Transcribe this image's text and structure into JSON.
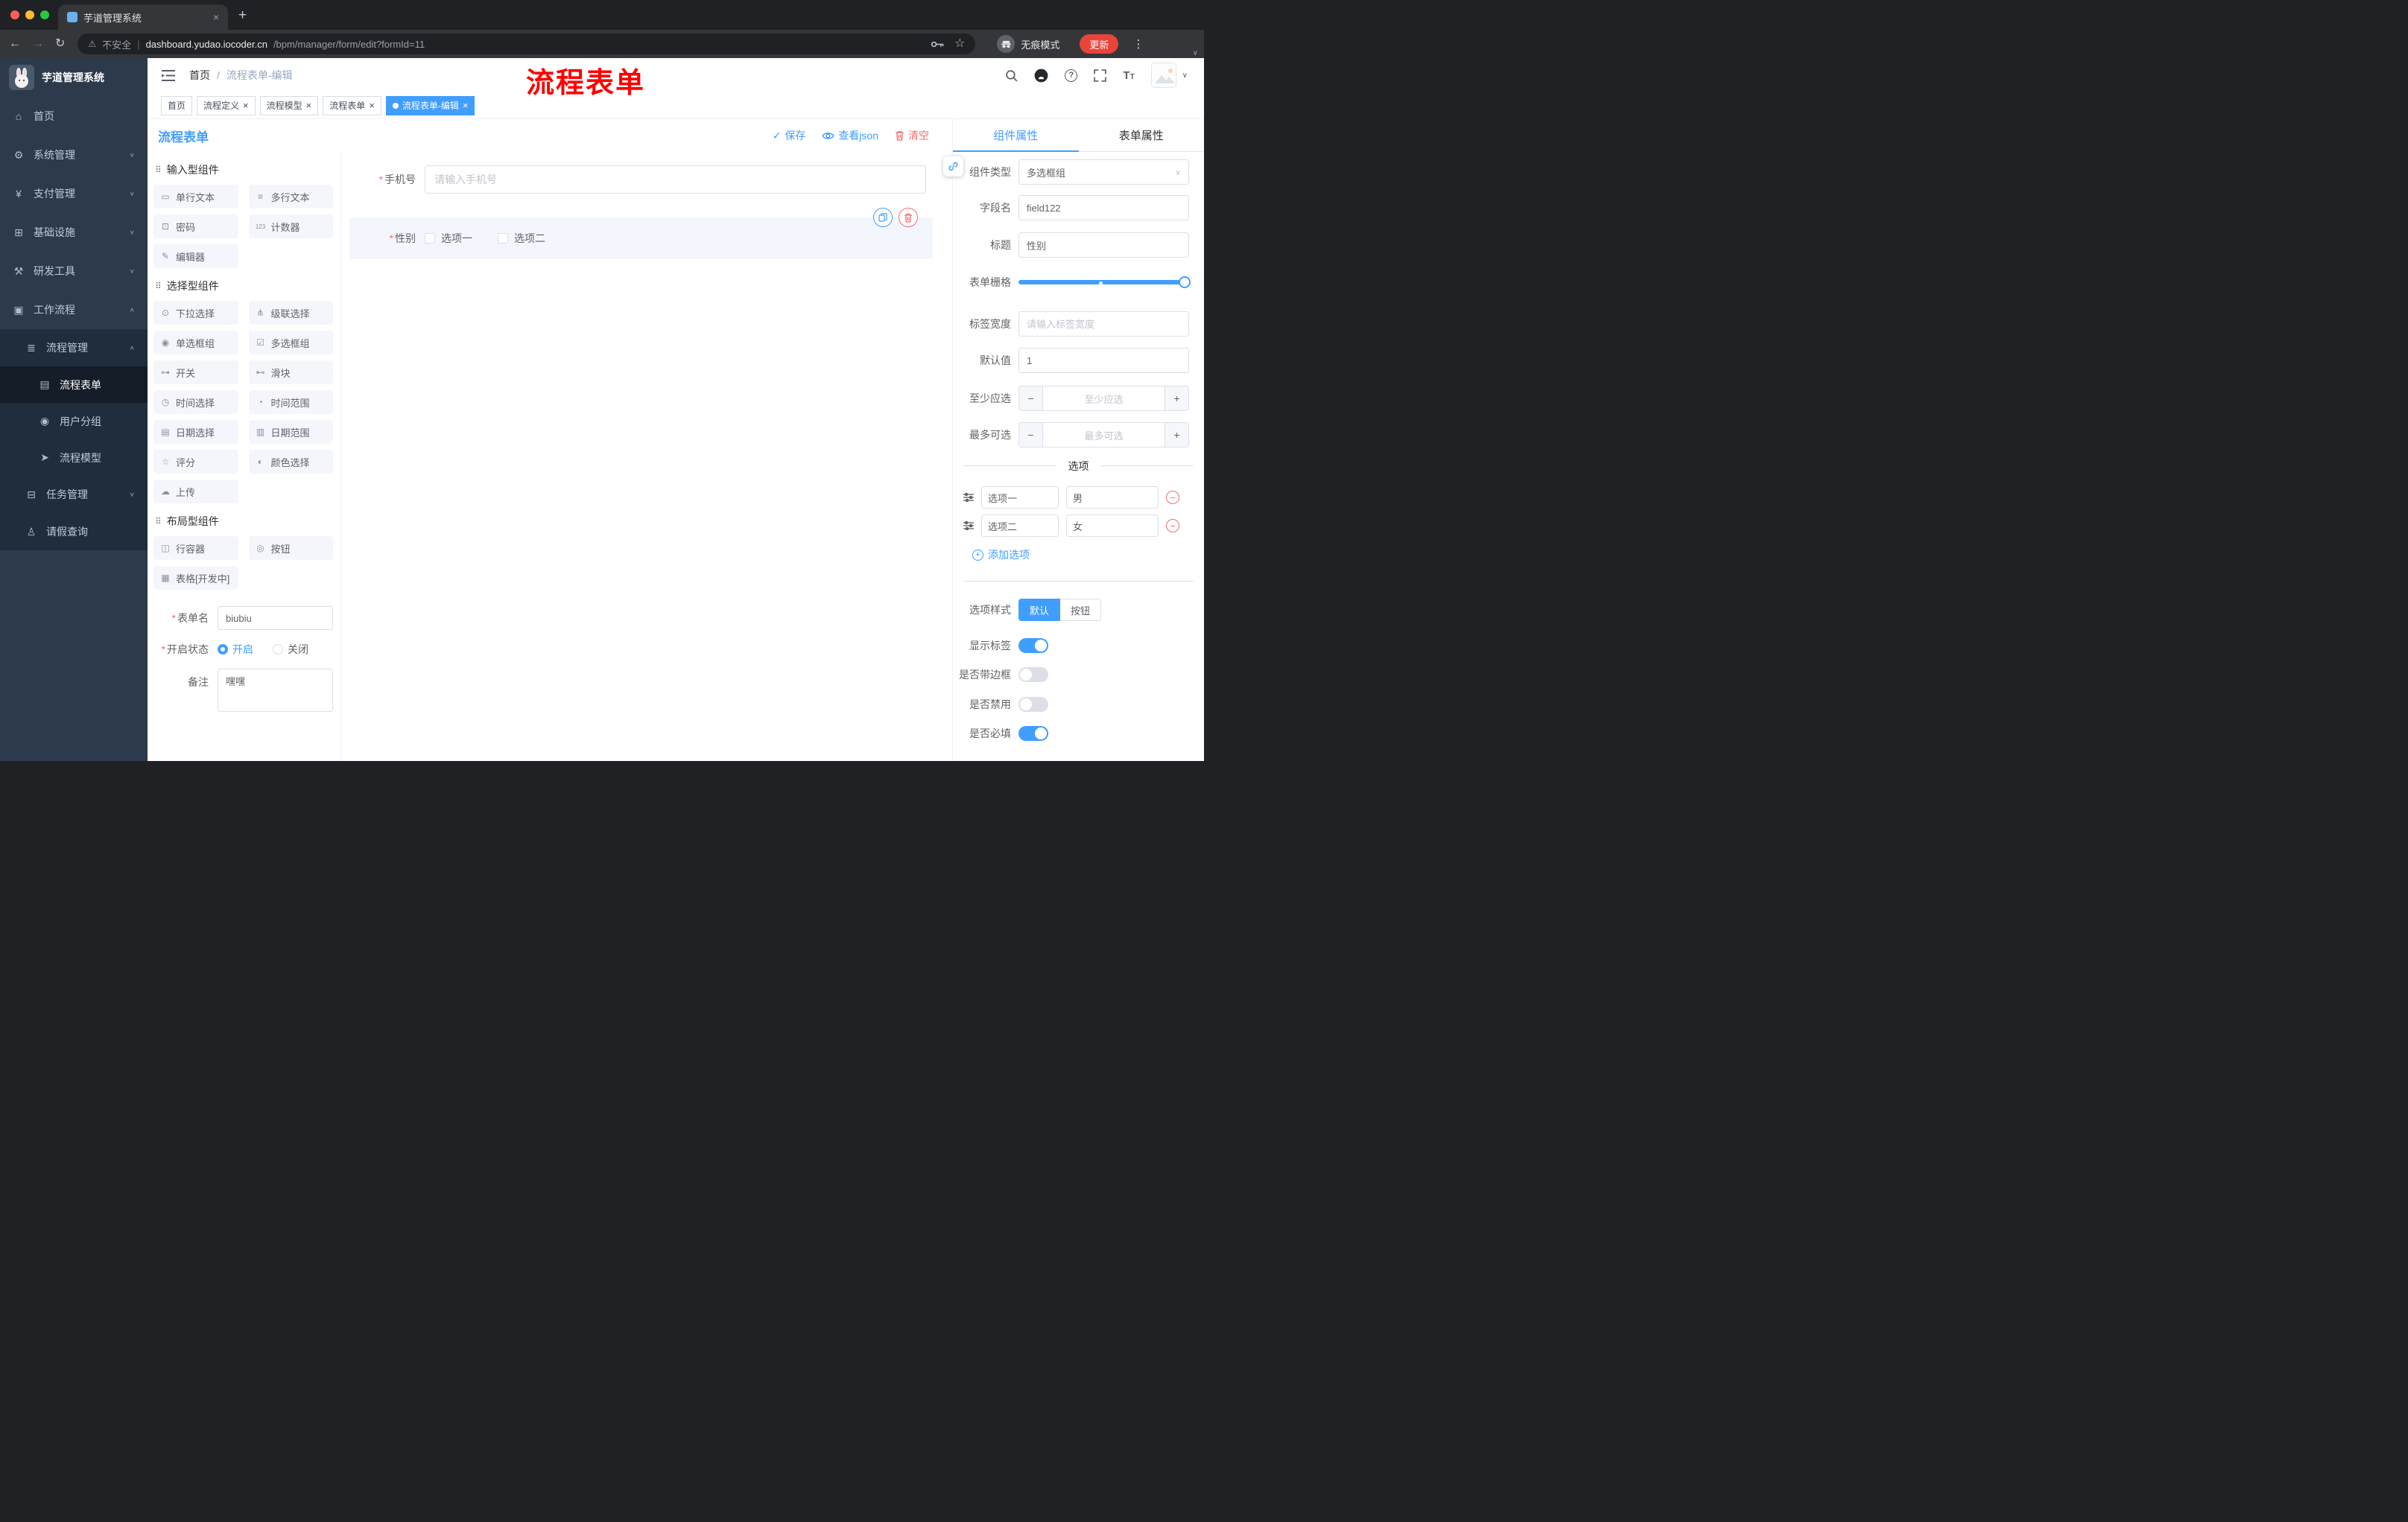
{
  "colors": {
    "primary": "#409EFF",
    "danger": "#F56C6C",
    "sidebar_bg": "#2D3A4B",
    "submenu_bg": "#1F2D3D",
    "annotation_red": "#FE0100",
    "update_button": "#E8443B",
    "tag_active": "#409EFF"
  },
  "icons": {
    "close": "×",
    "plus": "+",
    "minus": "−",
    "back": "←",
    "forward": "→",
    "reload": "↻",
    "warning": "⚠",
    "pipe": "|",
    "star": "☆",
    "menu_dots": "⋮",
    "chevron_down": "∨",
    "chevron_up": "∧",
    "required": "*",
    "check": "✓",
    "question": "?",
    "font_size": "T",
    "home": "⌂",
    "system": "⚙",
    "pay": "¥",
    "infra": "⊞",
    "devtools": "⚒",
    "workflow": "▣",
    "process_mgmt": "≣",
    "form": "▤",
    "users": "◉",
    "model": "➤",
    "task": "⊟",
    "leave": "♙",
    "drag": "⠿",
    "chip_input": "▭",
    "chip_textarea": "≡",
    "chip_password": "⊡",
    "chip_counter": "123",
    "chip_editor": "✎",
    "chip_select": "⊙",
    "chip_cascade": "⋔",
    "chip_radio": "◉",
    "chip_checkbox": "☑",
    "chip_switch": "⊶",
    "chip_slider": "⊷",
    "chip_time": "◷",
    "chip_time_range": "◔",
    "chip_date": "▤",
    "chip_date_range": "▥",
    "chip_rate": "☆",
    "chip_color": "◐",
    "chip_upload": "☁",
    "chip_row": "◫",
    "chip_button": "◎",
    "chip_table": "▦"
  },
  "browser": {
    "tab_title": "芋道管理系统",
    "security_label": "不安全",
    "url_host": "dashboard.yudao.iocoder.cn",
    "url_path": "/bpm/manager/form/edit?formId=11",
    "incognito_label": "无痕模式",
    "update_label": "更新"
  },
  "annotation": {
    "text": "流程表单"
  },
  "sidebar": {
    "logo_title": "芋道管理系统",
    "items": [
      {
        "label": "首页"
      },
      {
        "label": "系统管理"
      },
      {
        "label": "支付管理"
      },
      {
        "label": "基础设施"
      },
      {
        "label": "研发工具"
      },
      {
        "label": "工作流程"
      },
      {
        "label": "流程管理"
      },
      {
        "label": "流程表单"
      },
      {
        "label": "用户分组"
      },
      {
        "label": "流程模型"
      },
      {
        "label": "任务管理"
      },
      {
        "label": "请假查询"
      }
    ]
  },
  "header": {
    "breadcrumb": {
      "root": "首页",
      "separator": "/",
      "current": "流程表单-编辑"
    }
  },
  "tags": [
    {
      "label": "首页"
    },
    {
      "label": "流程定义"
    },
    {
      "label": "流程模型"
    },
    {
      "label": "流程表单"
    },
    {
      "label": "流程表单-编辑"
    }
  ],
  "designer": {
    "title": "流程表单",
    "actions": {
      "save": "保存",
      "view_json": "查看json",
      "clear": "清空"
    },
    "palette": {
      "sections": [
        {
          "title": "输入型组件",
          "items": [
            "单行文本",
            "多行文本",
            "密码",
            "计数器",
            "编辑器"
          ]
        },
        {
          "title": "选择型组件",
          "items": [
            "下拉选择",
            "级联选择",
            "单选框组",
            "多选框组",
            "开关",
            "滑块",
            "时间选择",
            "时间范围",
            "日期选择",
            "日期范围",
            "评分",
            "颜色选择",
            "上传"
          ]
        },
        {
          "title": "布局型组件",
          "items": [
            "行容器",
            "按钮",
            "表格[开发中]"
          ]
        }
      ]
    },
    "meta": {
      "name_label": "表单名",
      "name_value": "biubiu",
      "status_label": "开启状态",
      "status_on": "开启",
      "status_off": "关闭",
      "remark_label": "备注",
      "remark_value": "嘿嘿"
    },
    "canvas": {
      "phone": {
        "label": "手机号",
        "placeholder": "请输入手机号"
      },
      "gender": {
        "label": "性别",
        "option1": "选项一",
        "option2": "选项二"
      }
    }
  },
  "props": {
    "tab_component": "组件属性",
    "tab_form": "表单属性",
    "component_type": {
      "label": "组件类型",
      "value": "多选框组"
    },
    "field_name": {
      "label": "字段名",
      "value": "field122"
    },
    "title_row": {
      "label": "标题",
      "value": "性别"
    },
    "grid": {
      "label": "表单栅格"
    },
    "label_width": {
      "label": "标签宽度",
      "placeholder": "请输入标签宽度"
    },
    "default_value": {
      "label": "默认值",
      "value": "1"
    },
    "min_select": {
      "label": "至少应选",
      "placeholder": "至少应选"
    },
    "max_select": {
      "label": "最多可选",
      "placeholder": "最多可选"
    },
    "options_title": "选项",
    "options": [
      {
        "label": "选项一",
        "value": "男"
      },
      {
        "label": "选项二",
        "value": "女"
      }
    ],
    "add_option": "添加选项",
    "option_style": {
      "label": "选项样式",
      "default": "默认",
      "button": "按钮"
    },
    "show_label": {
      "label": "显示标签",
      "on": true
    },
    "border": {
      "label": "是否带边框",
      "on": false
    },
    "disabled": {
      "label": "是否禁用",
      "on": false
    },
    "required": {
      "label": "是否必填",
      "on": true
    }
  }
}
